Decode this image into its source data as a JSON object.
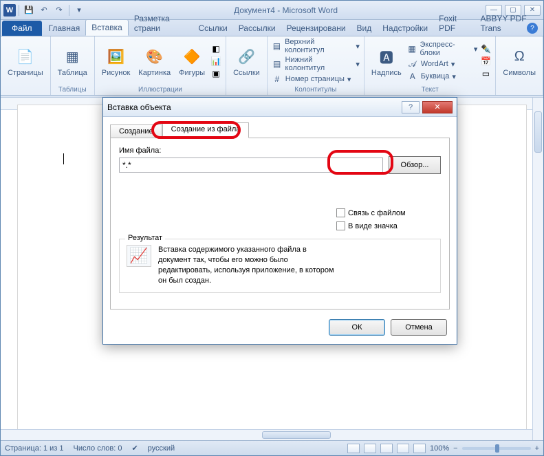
{
  "title": "Документ4 - Microsoft Word",
  "tabs": {
    "file": "Файл",
    "home": "Главная",
    "insert": "Вставка",
    "layout": "Разметка страни",
    "refs": "Ссылки",
    "mail": "Рассылки",
    "review": "Рецензировани",
    "view": "Вид",
    "addins": "Надстройки",
    "foxit": "Foxit PDF",
    "abbyy": "ABBYY PDF Trans"
  },
  "ribbon": {
    "pages": {
      "label": "Страницы",
      "btn": "Страницы"
    },
    "tables": {
      "label": "Таблицы",
      "btn": "Таблица"
    },
    "illus": {
      "label": "Иллюстрации",
      "pic": "Рисунок",
      "clip": "Картинка",
      "shapes": "Фигуры"
    },
    "links": {
      "label": "",
      "btn": "Ссылки"
    },
    "hf": {
      "label": "Колонтитулы",
      "top": "Верхний колонтитул",
      "bot": "Нижний колонтитул",
      "num": "Номер страницы"
    },
    "text": {
      "label": "Текст",
      "tb": "Надпись",
      "quick": "Экспресс-блоки",
      "wa": "WordArt",
      "drop": "Буквица"
    },
    "sym": {
      "label": "",
      "btn": "Символы"
    }
  },
  "status": {
    "page": "Страница: 1 из 1",
    "words": "Число слов: 0",
    "lang": "русский",
    "zoom": "100%"
  },
  "dialog": {
    "title": "Вставка объекта",
    "tab_create": "Создание",
    "tab_fromfile": "Создание из файла",
    "filename_label": "Имя файла:",
    "filename_value": "*.*",
    "browse": "Обзор...",
    "chk_link": "Связь с файлом",
    "chk_icon": "В виде значка",
    "result_legend": "Результат",
    "result_text": "Вставка содержимого указанного файла в документ так, чтобы его можно было редактировать, используя приложение, в котором он был создан.",
    "ok": "ОК",
    "cancel": "Отмена"
  }
}
